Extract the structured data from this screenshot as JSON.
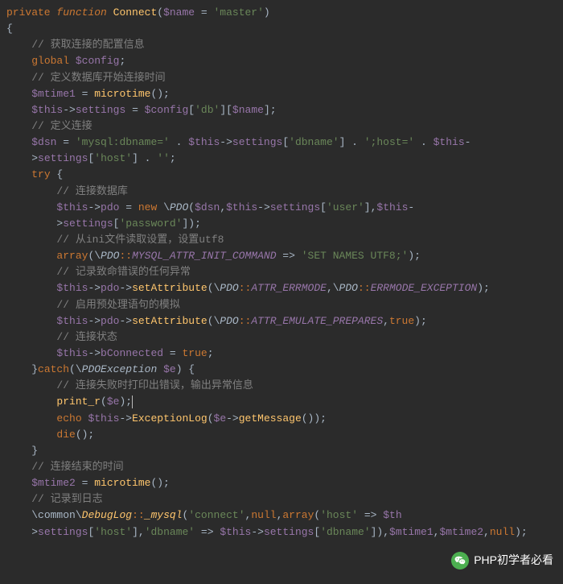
{
  "code": {
    "l1_private": "private",
    "l1_function": "function",
    "l1_fname": "Connect",
    "l1_params_open": "(",
    "l1_var": "$name",
    "l1_eq": " = ",
    "l1_str": "'master'",
    "l1_params_close": ")",
    "l2": "{",
    "l3_cmt": "// 获取连接的配置信息",
    "l4_global": "global",
    "l4_var": "$config",
    "l4_semi": ";",
    "l5_cmt": "// 定义数据库开始连接时间",
    "l6_var": "$mtime1",
    "l6_eq": " = ",
    "l6_fn": "microtime",
    "l6_parens": "();",
    "l7_this": "$this",
    "l7_arrow": "->",
    "l7_prop": "settings",
    "l7_eq": " = ",
    "l7_var": "$config",
    "l7_idx1": "[",
    "l7_str1": "'db'",
    "l7_idx2": "][",
    "l7_var2": "$name",
    "l7_idx3": "];",
    "l8_cmt": "// 定义连接",
    "l9_var": "$dsn",
    "l9_eq": " = ",
    "l9_str1": "'mysql:dbname='",
    "l9_dot": " . ",
    "l9_this": "$this",
    "l9_arrow": "->",
    "l9_prop": "settings",
    "l9_idx1": "[",
    "l9_str2": "'dbname'",
    "l9_idx2": "] . ",
    "l9_str3": "';host='",
    "l9_dot2": " . ",
    "l9_this2": "$this",
    "l9_hyph": "-",
    "l10_arrow": ">",
    "l10_prop": "settings",
    "l10_idx1": "[",
    "l10_str": "'host'",
    "l10_idx2": "] . ",
    "l10_str2": "''",
    "l10_semi": ";",
    "l11_try": "try",
    "l11_brace": " {",
    "l12_cmt": "// 连接数据库",
    "l13_this": "$this",
    "l13_arrow": "->",
    "l13_prop": "pdo",
    "l13_eq": " = ",
    "l13_new": "new",
    "l13_bs": " \\",
    "l13_cls": "PDO",
    "l13_open": "(",
    "l13_dsn": "$dsn",
    "l13_comma": ",",
    "l13_this2": "$this",
    "l13_arrow2": "->",
    "l13_prop2": "settings",
    "l13_idx1": "[",
    "l13_str1": "'user'",
    "l13_idx2": "],",
    "l13_this3": "$this",
    "l13_hyph": "-",
    "l14_arrow": ">",
    "l14_prop": "settings",
    "l14_idx1": "[",
    "l14_str": "'password'",
    "l14_idx2": "]);",
    "l15_cmt": "// 从ini文件读取设置，设置utf8",
    "l16_array": "array",
    "l16_open": "(\\",
    "l16_cls": "PDO",
    "l16_dcolon": "::",
    "l16_const": "MYSQL_ATTR_INIT_COMMAND",
    "l16_fat": " => ",
    "l16_str": "'SET NAMES UTF8;'",
    "l16_close": ");",
    "l17_cmt": "// 记录致命错误的任何异常",
    "l18_this": "$this",
    "l18_arrow": "->",
    "l18_prop": "pdo",
    "l18_arrow2": "->",
    "l18_fn": "setAttribute",
    "l18_open": "(\\",
    "l18_cls": "PDO",
    "l18_dcolon": "::",
    "l18_const1": "ATTR_ERRMODE",
    "l18_comma": ",\\",
    "l18_cls2": "PDO",
    "l18_dcolon2": "::",
    "l18_const2": "ERRMODE_EXCEPTION",
    "l18_close": ");",
    "l19_cmt": "// 启用预处理语句的模拟",
    "l20_this": "$this",
    "l20_arrow": "->",
    "l20_prop": "pdo",
    "l20_arrow2": "->",
    "l20_fn": "setAttribute",
    "l20_open": "(\\",
    "l20_cls": "PDO",
    "l20_dcolon": "::",
    "l20_const": "ATTR_EMULATE_PREPARES",
    "l20_comma": ",",
    "l20_true": "true",
    "l20_close": ");",
    "l21_cmt": "// 连接状态",
    "l22_this": "$this",
    "l22_arrow": "->",
    "l22_prop": "bConnected",
    "l22_eq": " = ",
    "l22_true": "true",
    "l22_semi": ";",
    "l23_close": "}",
    "l23_catch": "catch",
    "l23_open": "(\\",
    "l23_cls": "PDOException",
    "l23_var": " $e",
    "l23_close2": ") {",
    "l24_cmt": "// 连接失败时打印出错误，输出异常信息",
    "l25_fn": "print_r",
    "l25_open": "(",
    "l25_var": "$e",
    "l25_close": ");",
    "l26_echo": "echo",
    "l26_sp": " ",
    "l26_this": "$this",
    "l26_arrow": "->",
    "l26_fn": "ExceptionLog",
    "l26_open": "(",
    "l26_var": "$e",
    "l26_arrow2": "->",
    "l26_fn2": "getMessage",
    "l26_close": "());",
    "l27_die": "die",
    "l27_close": "();",
    "l28": "}",
    "l29_cmt": "// 连接结束的时间",
    "l30_var": "$mtime2",
    "l30_eq": " = ",
    "l30_fn": "microtime",
    "l30_close": "();",
    "l31_cmt": "// 记录到日志",
    "l32_bs": "\\",
    "l32_ns1": "common",
    "l32_bs2": "\\",
    "l32_cls": "DebugLog",
    "l32_dcolon": "::",
    "l32_fn": "_mysql",
    "l32_open": "(",
    "l32_str1": "'connect'",
    "l32_comma": ",",
    "l32_null1": "null",
    "l32_comma2": ",",
    "l32_array": "array",
    "l32_open2": "(",
    "l32_str2": "'host'",
    "l32_fat": " => ",
    "l32_this": "$th",
    "l33_arrow": ">",
    "l33_prop": "settings",
    "l33_idx1": "[",
    "l33_str1": "'host'",
    "l33_idx2": "],",
    "l33_str2": "'dbname'",
    "l33_fat": " => ",
    "l33_this": "$this",
    "l33_arrow2": "->",
    "l33_prop2": "settings",
    "l33_idx3": "[",
    "l33_str3": "'dbname'",
    "l33_idx4": "]),",
    "l33_var1": "$mtime1",
    "l33_comma": ",",
    "l33_var2": "$mtime2",
    "l33_comma2": ",",
    "l33_null": "null",
    "l33_close": ");"
  },
  "watermark": "PHP初学者必看"
}
